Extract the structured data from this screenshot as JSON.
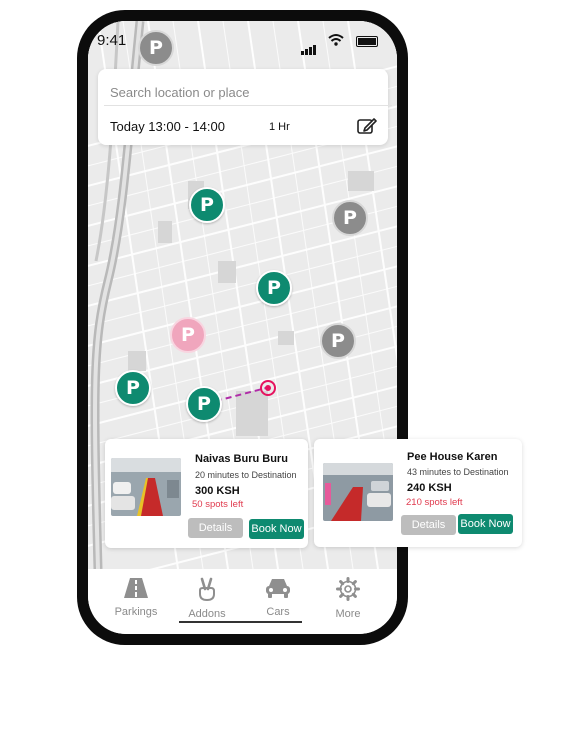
{
  "status_bar": {
    "time": "9:41"
  },
  "search": {
    "placeholder": "Search location or place",
    "time_range": "Today 13:00 - 14:00",
    "duration": "1 Hr"
  },
  "map": {
    "pin_letter": "P",
    "colors": {
      "available": "#0e8a70",
      "unavailable": "#8c8c8c",
      "highlight": "#f0a6bd",
      "route": "#b02ca8",
      "destination": "#e6135f"
    }
  },
  "cards": [
    {
      "name": "Naivas Buru Buru",
      "distance": "20 minutes to Destination",
      "price": "300 KSH",
      "spots": "50 spots left",
      "details_label": "Details",
      "book_label": "Book Now"
    },
    {
      "name": "Pee House Karen",
      "distance": "43 minutes to Destination",
      "price": "240 KSH",
      "spots": "210 spots left",
      "details_label": "Details",
      "book_label": "Book Now"
    }
  ],
  "nav": {
    "items": [
      {
        "label": "Parkings",
        "icon": "road-icon"
      },
      {
        "label": "Addons",
        "icon": "peace-hand-icon"
      },
      {
        "label": "Cars",
        "icon": "car-icon"
      },
      {
        "label": "More",
        "icon": "gear-icon"
      }
    ]
  }
}
